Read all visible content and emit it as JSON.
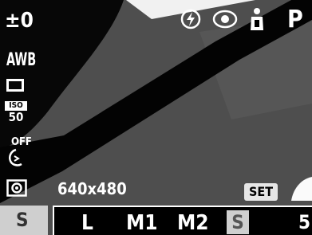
{
  "top": {
    "exposure_comp": "±0",
    "mode": "P"
  },
  "side": {
    "white_balance": "AWB",
    "iso_top": "ISO",
    "iso_bottom": "50",
    "self_timer": "OFF"
  },
  "resolution": "640x480",
  "set_label": "SET",
  "size_options": [
    "L",
    "M1",
    "M2",
    "S"
  ],
  "selected_size": "S",
  "corner_badge": "S",
  "shots_remaining_partial": "5",
  "icons": [
    "flash-off-icon",
    "red-eye-icon",
    "person-mode-icon",
    "single-shot-icon",
    "self-timer-icon",
    "metering-icon",
    "set-icon"
  ]
}
